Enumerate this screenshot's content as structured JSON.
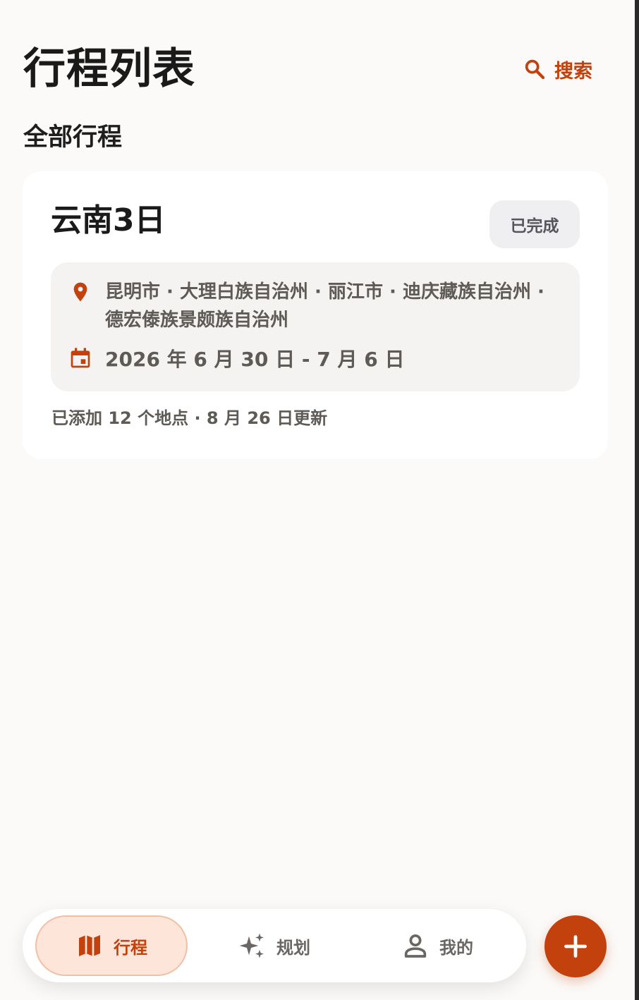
{
  "header": {
    "title": "行程列表",
    "search_label": "搜索"
  },
  "section": {
    "title": "全部行程"
  },
  "trip": {
    "name": "云南3日",
    "status": "已完成",
    "locations_line1": "昆明市 · 大理白族自治州 · 丽江市 · 迪庆藏族自治州 ·",
    "locations_line2": "德宏傣族景颇族自治州",
    "dates": "2026 年 6 月 30 日 - 7 月 6 日",
    "meta": "已添加 12 个地点 · 8 月 26 日更新"
  },
  "bottom_nav": {
    "items": [
      {
        "label": "行程",
        "icon": "map-icon",
        "active": true
      },
      {
        "label": "规划",
        "icon": "sparkle-icon",
        "active": false
      },
      {
        "label": "我的",
        "icon": "person-icon",
        "active": false
      }
    ]
  },
  "fab": {
    "icon": "plus-icon"
  },
  "colors": {
    "accent": "#c2410c",
    "background": "#fbfaf8",
    "card": "#ffffff",
    "info_box": "#f4f3f2",
    "badge_bg": "#efeff2",
    "active_nav_bg": "#fde6d9"
  }
}
